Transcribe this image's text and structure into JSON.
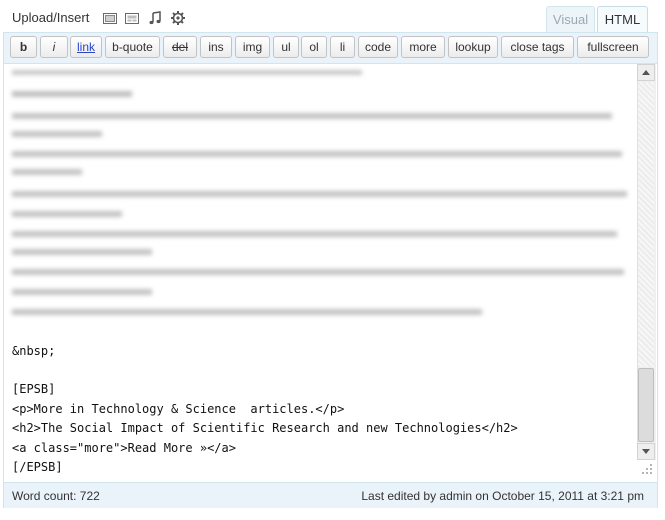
{
  "media_bar": {
    "upload_label": "Upload/Insert",
    "icons": [
      "image-icon",
      "video-icon",
      "audio-icon",
      "media-gear-icon"
    ]
  },
  "tabs": {
    "visual": "Visual",
    "html": "HTML",
    "active": "html"
  },
  "quicktags": [
    {
      "label": "b",
      "name": "qt-bold-button"
    },
    {
      "label": "i",
      "name": "qt-italic-button"
    },
    {
      "label": "link",
      "name": "qt-link-button"
    },
    {
      "label": "b-quote",
      "name": "qt-blockquote-button"
    },
    {
      "label": "del",
      "name": "qt-del-button"
    },
    {
      "label": "ins",
      "name": "qt-ins-button"
    },
    {
      "label": "img",
      "name": "qt-img-button"
    },
    {
      "label": "ul",
      "name": "qt-ul-button"
    },
    {
      "label": "ol",
      "name": "qt-ol-button"
    },
    {
      "label": "li",
      "name": "qt-li-button"
    },
    {
      "label": "code",
      "name": "qt-code-button"
    },
    {
      "label": "more",
      "name": "qt-more-button"
    },
    {
      "label": "lookup",
      "name": "qt-lookup-button"
    },
    {
      "label": "close tags",
      "name": "qt-close-tags-button"
    },
    {
      "label": "fullscreen",
      "name": "qt-fullscreen-button"
    }
  ],
  "editor": {
    "code_lines": [
      "&nbsp;",
      "",
      "[EPSB]",
      "<p>More in Technology & Science  articles.</p>",
      "<h2>The Social Impact of Scientific Research and new Technologies</h2>",
      "<a class=\"more\">Read More »</a>",
      "[/EPSB]"
    ]
  },
  "status": {
    "word_count": "Word count: 722",
    "last_edited": "Last edited by admin on October 15, 2011 at 3:21 pm"
  }
}
